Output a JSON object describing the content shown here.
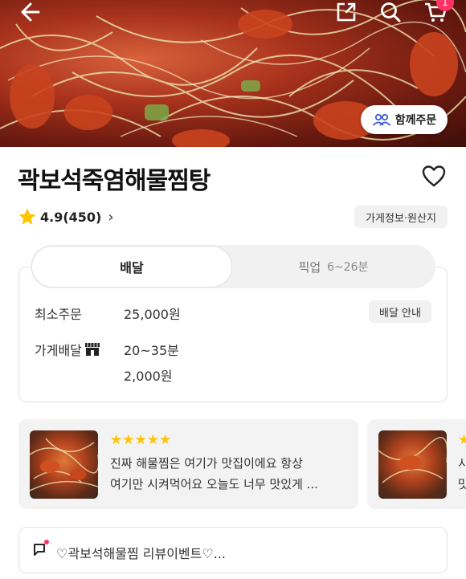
{
  "header": {
    "cart_badge": "1",
    "together_order_label": "함께주문"
  },
  "store": {
    "name": "곽보석죽염해물찜탕",
    "rating": "4.9(450)",
    "info_chip": "가게정보·원산지"
  },
  "tabs": {
    "delivery": "배달",
    "pickup": "픽업",
    "pickup_time": "6~26분"
  },
  "delivery_info": {
    "min_order_label": "최소주문",
    "min_order_value": "25,000원",
    "guide_label": "배달 안내",
    "store_delivery_label": "가게배달",
    "delivery_time": "20~35분",
    "delivery_fee": "2,000원"
  },
  "reviews": [
    {
      "stars": "★★★★★",
      "line1": "진짜 해물찜은 여기가 맛집이에요 항상",
      "line2": "여기만 시켜먹어요 오늘도 너무 맛있게 ..."
    },
    {
      "stars": "★",
      "line1": "시",
      "line2": "맛"
    }
  ],
  "event": {
    "text": "♡곽보석해물찜 리뷰이벤트♡..."
  },
  "colors": {
    "accent": "#ff3366",
    "star": "#ffc400",
    "together_icon": "#3c5bd6"
  }
}
